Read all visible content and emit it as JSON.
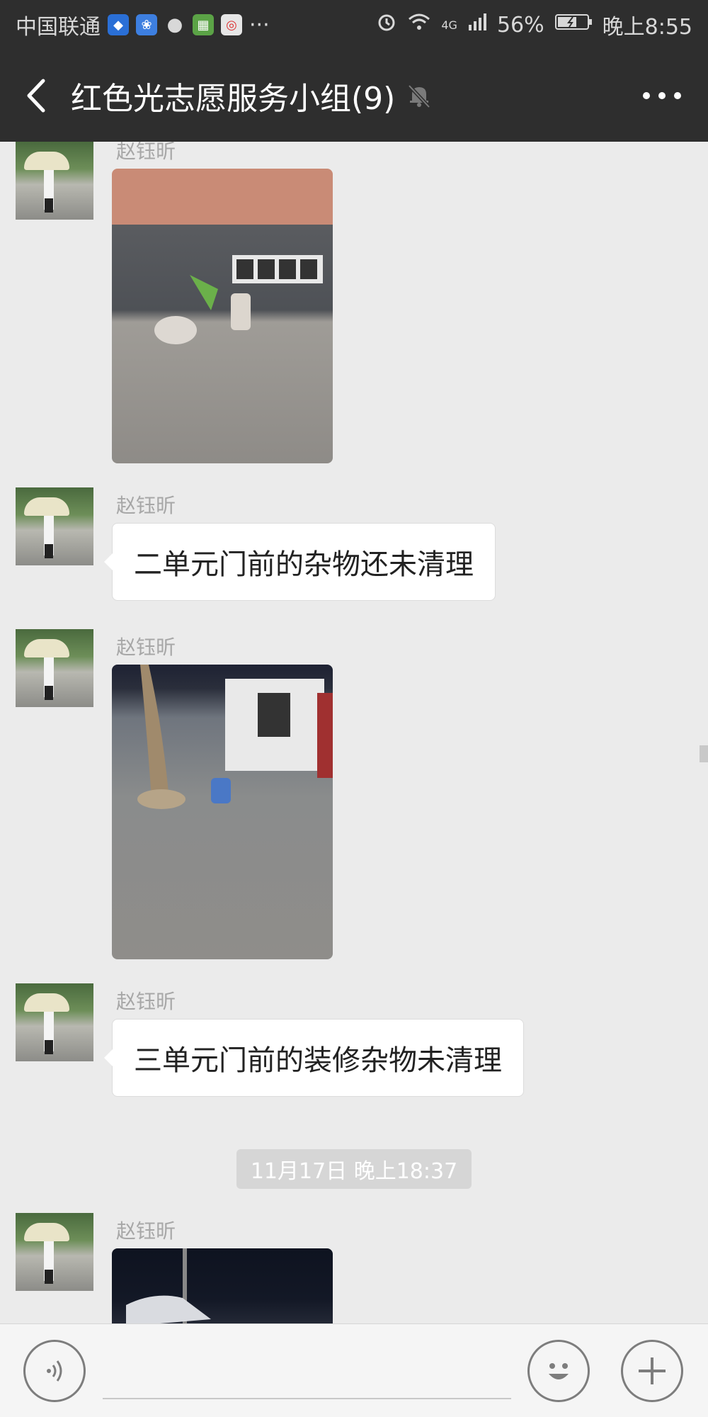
{
  "status_bar": {
    "carrier": "中国联通",
    "more": "···",
    "network": "4G",
    "battery": "56%",
    "time": "晚上8:55"
  },
  "header": {
    "title": "红色光志愿服务小组(9)",
    "icons": [
      "back-arrow-icon",
      "mute-bell-icon",
      "more-dots-icon"
    ]
  },
  "messages": [
    {
      "sender": "赵钰昕",
      "type": "image"
    },
    {
      "sender": "赵钰昕",
      "type": "text",
      "text": "二单元门前的杂物还未清理"
    },
    {
      "sender": "赵钰昕",
      "type": "image"
    },
    {
      "sender": "赵钰昕",
      "type": "text",
      "text": "三单元门前的装修杂物未清理"
    },
    {
      "type": "timestamp",
      "text": "11月17日 晚上18:37"
    },
    {
      "sender": "赵钰昕",
      "type": "image"
    }
  ],
  "input_bar": {
    "icons": [
      "voice-icon",
      "emoji-icon",
      "plus-icon"
    ]
  }
}
